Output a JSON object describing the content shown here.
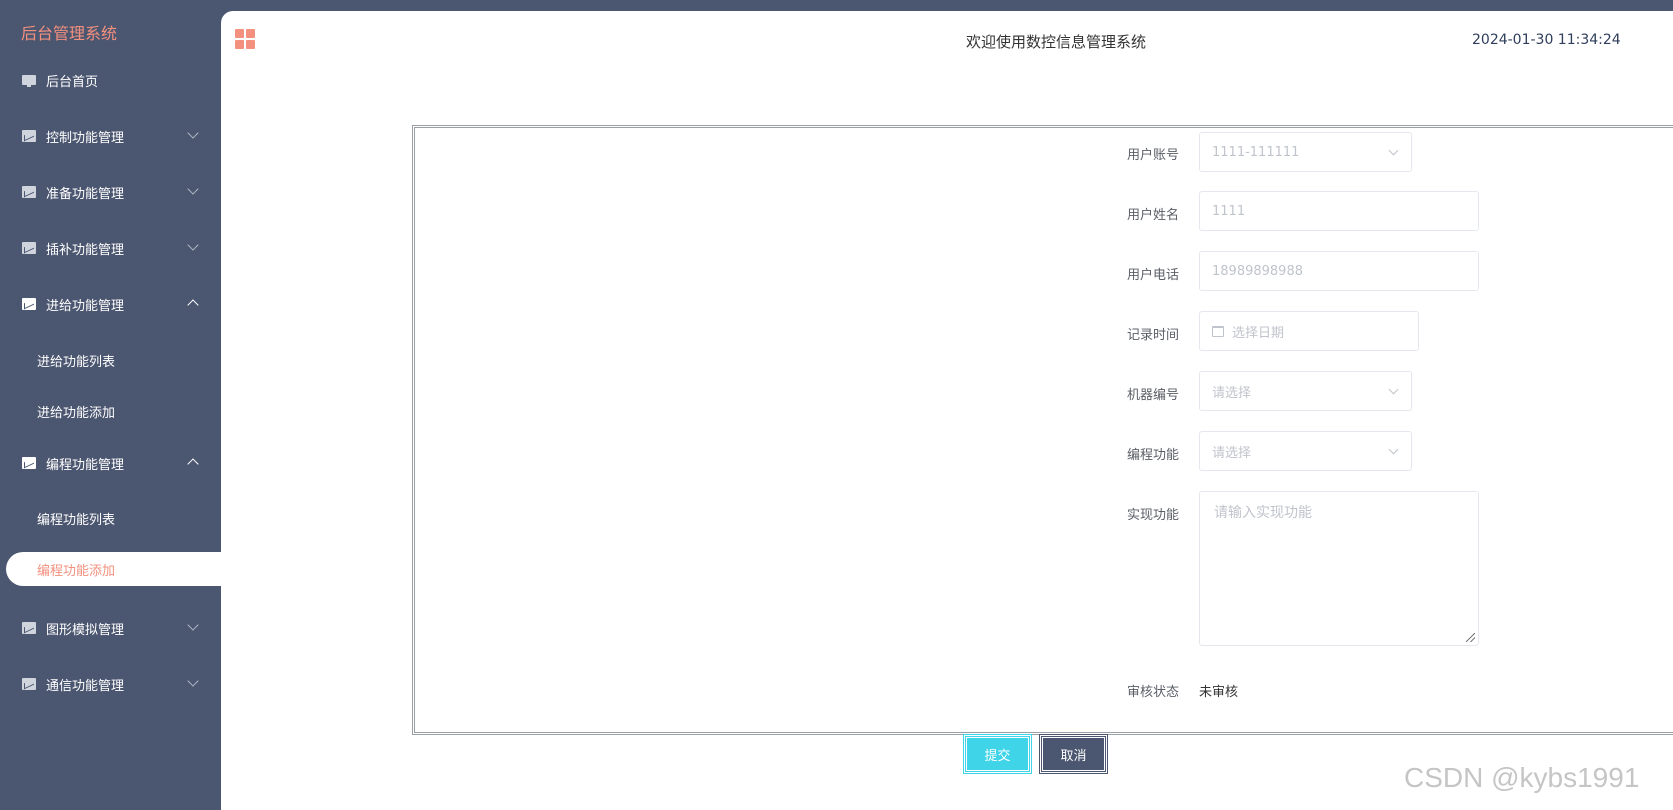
{
  "sidebar": {
    "brand": "后台管理系统",
    "items": [
      {
        "label": "后台首页",
        "icon": "monitor-icon"
      },
      {
        "label": "控制功能管理",
        "icon": "chart-icon"
      },
      {
        "label": "准备功能管理",
        "icon": "chart-icon"
      },
      {
        "label": "插补功能管理",
        "icon": "chart-icon"
      },
      {
        "label": "进给功能管理",
        "icon": "chart-icon",
        "expanded": true,
        "children": [
          "进给功能列表",
          "进给功能添加"
        ]
      },
      {
        "label": "编程功能管理",
        "icon": "chart-icon",
        "expanded": true,
        "children": [
          "编程功能列表",
          "编程功能添加"
        ]
      },
      {
        "label": "图形模拟管理",
        "icon": "chart-icon"
      },
      {
        "label": "通信功能管理",
        "icon": "chart-icon"
      }
    ],
    "active_item": "编程功能添加"
  },
  "header": {
    "welcome": "欢迎使用数控信息管理系统",
    "datetime": "2024-01-30 11:34:24"
  },
  "form": {
    "account": {
      "label": "用户账号",
      "value": "1111-111111"
    },
    "name": {
      "label": "用户姓名",
      "value": "1111"
    },
    "phone": {
      "label": "用户电话",
      "value": "18989898988"
    },
    "record_time": {
      "label": "记录时间",
      "placeholder": "选择日期"
    },
    "machine_no": {
      "label": "机器编号",
      "placeholder": "请选择"
    },
    "programming": {
      "label": "编程功能",
      "placeholder": "请选择"
    },
    "implementation": {
      "label": "实现功能",
      "placeholder": "请输入实现功能"
    },
    "review_status": {
      "label": "审核状态",
      "value": "未审核"
    }
  },
  "actions": {
    "submit": "提交",
    "cancel": "取消"
  },
  "watermark": "CSDN @kybs1991",
  "colors": {
    "sidebar_bg": "#4b5670",
    "accent": "#f3907e",
    "submit": "#3fd4e8"
  }
}
